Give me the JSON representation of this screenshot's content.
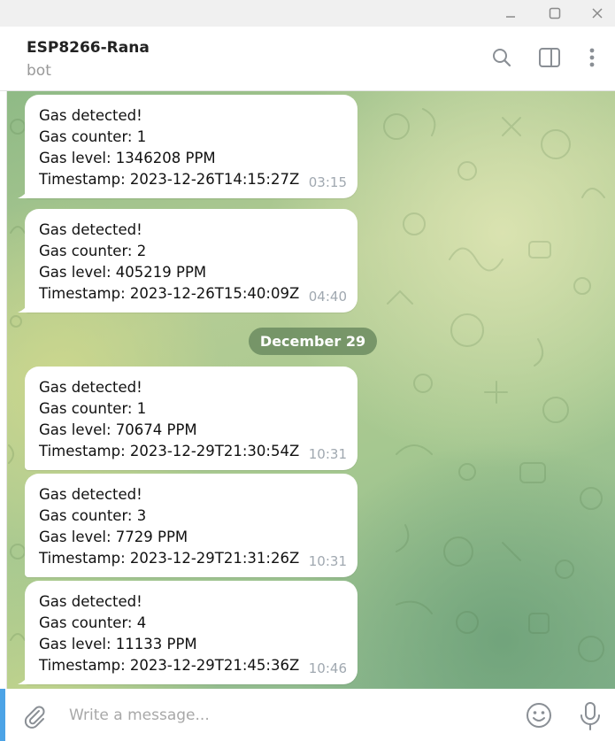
{
  "header": {
    "chat_name": "ESP8266-Rana",
    "chat_status": "bot",
    "icons": [
      "search-icon",
      "side-panel-icon",
      "more-vertical-icon"
    ]
  },
  "date_separator": "December 29",
  "messages": [
    {
      "lines": [
        "Gas detected!",
        "Gas counter: 1",
        "Gas level: 1346208 PPM",
        "Timestamp: 2023-12-26T14:15:27Z"
      ],
      "time": "03:15"
    },
    {
      "lines": [
        "Gas detected!",
        "Gas counter: 2",
        "Gas level: 405219 PPM",
        "Timestamp: 2023-12-26T15:40:09Z"
      ],
      "time": "04:40"
    },
    {
      "lines": [
        "Gas detected!",
        "Gas counter: 1",
        "Gas level: 70674 PPM",
        "Timestamp: 2023-12-29T21:30:54Z"
      ],
      "time": "10:31"
    },
    {
      "lines": [
        "Gas detected!",
        "Gas counter: 3",
        "Gas level: 7729 PPM",
        "Timestamp: 2023-12-29T21:31:26Z"
      ],
      "time": "10:31"
    },
    {
      "lines": [
        "Gas detected!",
        "Gas counter: 4",
        "Gas level: 11133 PPM",
        "Timestamp: 2023-12-29T21:45:36Z"
      ],
      "time": "10:46"
    }
  ],
  "composer": {
    "placeholder": "Write a message...",
    "icons": [
      "paperclip-icon",
      "emoji-icon",
      "microphone-icon"
    ]
  },
  "colors": {
    "accent": "#4ca3e6",
    "date_pill": "#6c8c60",
    "timestamp": "#a0a8b0"
  }
}
